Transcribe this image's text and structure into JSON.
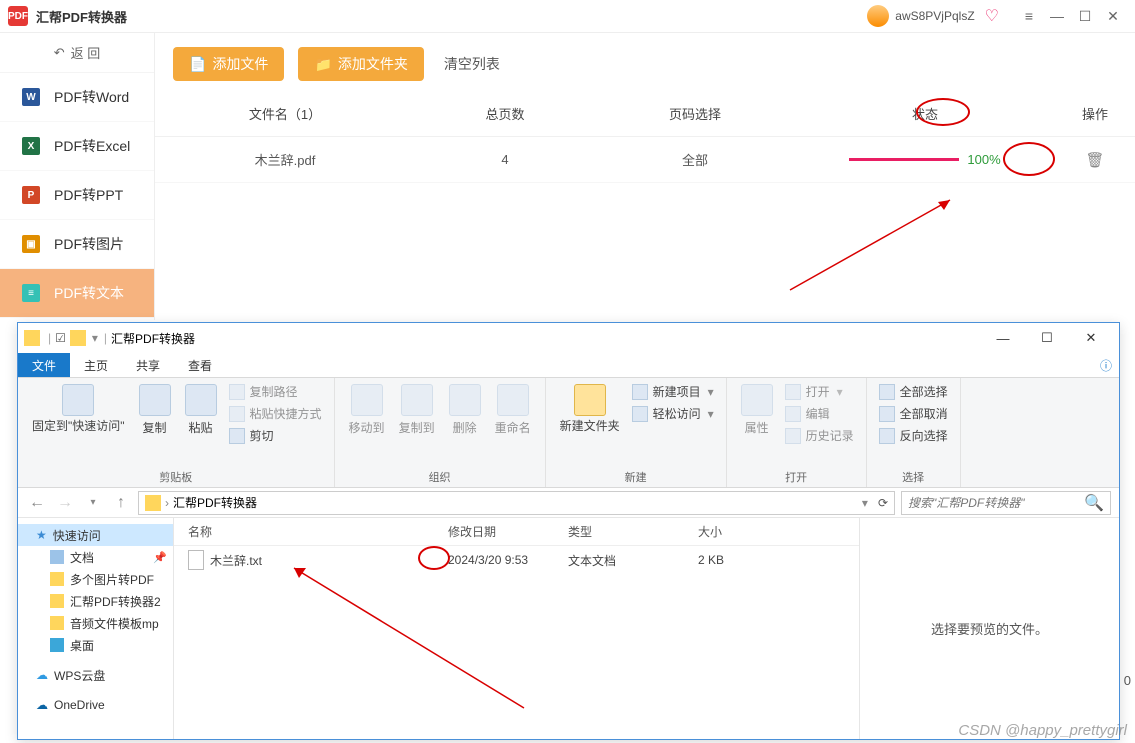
{
  "app": {
    "title": "汇帮PDF转换器",
    "user": "awS8PVjPqlsZ",
    "back": "返 回",
    "nav": [
      {
        "label": "PDF转Word",
        "color": "#2b579a",
        "abbr": "W"
      },
      {
        "label": "PDF转Excel",
        "color": "#217346",
        "abbr": "X"
      },
      {
        "label": "PDF转PPT",
        "color": "#d24726",
        "abbr": "P"
      },
      {
        "label": "PDF转图片",
        "color": "#e08e00",
        "abbr": "▣"
      },
      {
        "label": "PDF转文本",
        "color": "#35c1b5",
        "abbr": "≡"
      }
    ],
    "toolbar": {
      "add_file": "添加文件",
      "add_folder": "添加文件夹",
      "clear": "清空列表"
    },
    "thead": {
      "name": "文件名（1）",
      "pages": "总页数",
      "range": "页码选择",
      "status": "状态",
      "ops": "操作"
    },
    "row": {
      "name": "木兰辞.pdf",
      "pages": "4",
      "range": "全部",
      "progress": "100%"
    }
  },
  "explorer": {
    "title": "汇帮PDF转换器",
    "tabs": {
      "file": "文件",
      "home": "主页",
      "share": "共享",
      "view": "查看"
    },
    "ribbon": {
      "pin": "固定到\"快速访问\"",
      "copy": "复制",
      "paste": "粘贴",
      "copy_path": "复制路径",
      "paste_shortcut": "粘贴快捷方式",
      "cut": "剪切",
      "clipboard": "剪贴板",
      "move_to": "移动到",
      "copy_to": "复制到",
      "delete": "删除",
      "rename": "重命名",
      "organize": "组织",
      "new_folder": "新建文件夹",
      "new_item": "新建项目",
      "easy_access": "轻松访问",
      "new": "新建",
      "properties": "属性",
      "open": "打开",
      "edit": "编辑",
      "history": "历史记录",
      "open_g": "打开",
      "select_all": "全部选择",
      "select_none": "全部取消",
      "invert": "反向选择",
      "select": "选择"
    },
    "crumb": "汇帮PDF转换器",
    "search_ph": "搜索\"汇帮PDF转换器\"",
    "tree": {
      "quick": "快速访问",
      "docs": "文档",
      "multi": "多个图片转PDF",
      "conv": "汇帮PDF转换器2",
      "audio": "音频文件模板mp",
      "desktop": "桌面",
      "wps": "WPS云盘",
      "onedrive": "OneDrive"
    },
    "fhead": {
      "name": "名称",
      "date": "修改日期",
      "type": "类型",
      "size": "大小"
    },
    "frow": {
      "name": "木兰辞.txt",
      "date": "2024/3/20 9:53",
      "type": "文本文档",
      "size": "2 KB"
    },
    "preview": "选择要预览的文件。"
  },
  "watermark": "CSDN @happy_prettygirl",
  "footer0": "0"
}
